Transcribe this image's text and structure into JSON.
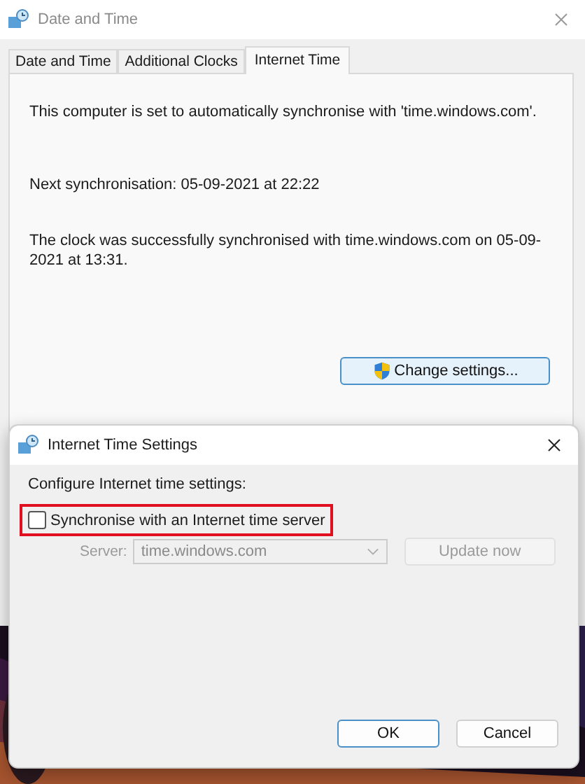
{
  "window": {
    "title": "Date and Time"
  },
  "tabs": [
    {
      "label": "Date and Time",
      "selected": false
    },
    {
      "label": "Additional Clocks",
      "selected": false
    },
    {
      "label": "Internet Time",
      "selected": true
    }
  ],
  "panel": {
    "status": "This computer is set to automatically synchronise with 'time.windows.com'.",
    "next_sync": "Next synchronisation: 05-09-2021 at 22:22",
    "last_sync": "The clock was successfully synchronised with time.windows.com on 05-09-2021 at 13:31.",
    "change_button": "Change settings..."
  },
  "dialog": {
    "title": "Internet Time Settings",
    "heading": "Configure Internet time settings:",
    "checkbox": {
      "label": "Synchronise with an Internet time server",
      "checked": false,
      "highlighted": true
    },
    "server": {
      "label": "Server:",
      "value": "time.windows.com",
      "disabled": true
    },
    "update_button": {
      "label": "Update now",
      "disabled": true
    },
    "buttons": [
      {
        "label": "OK",
        "default": true
      },
      {
        "label": "Cancel",
        "default": false
      }
    ]
  }
}
